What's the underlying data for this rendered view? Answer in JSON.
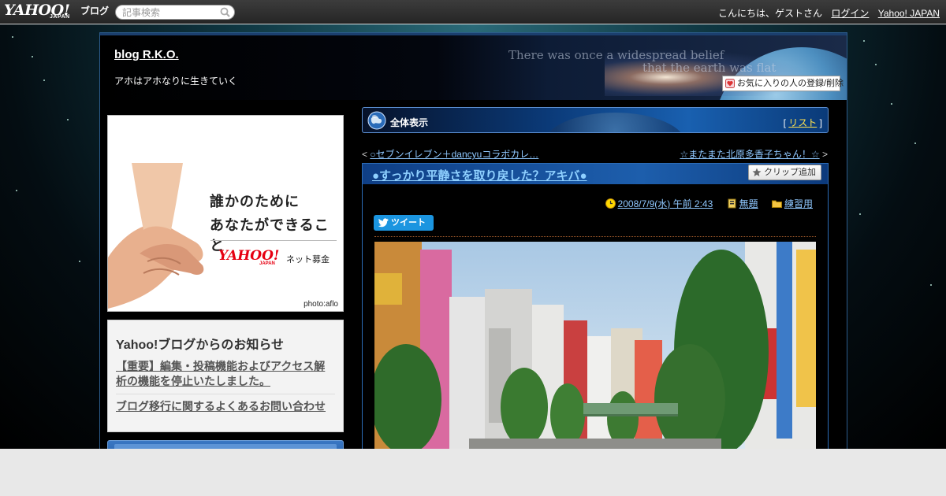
{
  "topbar": {
    "logo_main": "YAHOO!",
    "logo_sub": "JAPAN",
    "logo_service": "ブログ",
    "search_placeholder": "記事検索",
    "greeting": "こんにちは、ゲストさん",
    "login": "ログイン",
    "yahoo_japan": "Yahoo! JAPAN"
  },
  "header": {
    "blog_title": "blog R.K.O.",
    "blog_subtitle": "アホはアホなりに生きていく",
    "quote_line1": "There was once a widespread belief",
    "quote_line2": "that the earth was flat",
    "favorite_button": "お気に入りの人の登録/削除"
  },
  "ad": {
    "line1": "誰かのために",
    "line2": "あなたができること",
    "logo": "YAHOO!",
    "logo_sub": "JAPAN",
    "tagline": "ネット募金",
    "credit": "photo:aflo"
  },
  "notice": {
    "title": "Yahoo!ブログからのお知らせ",
    "items": [
      "【重要】編集・投稿機能およびアクセス解析の機能を停止いたしました。",
      "ブログ移行に関するよくあるお問い合わせ"
    ]
  },
  "main": {
    "section_title": "全体表示",
    "list_bracket_open": "[",
    "list_link": "リスト",
    "list_bracket_close": "]",
    "prev_marker": "<",
    "prev_link": "○セブンイレブン＋dancyuコラボカレ…",
    "next_link": "☆またまた北原多香子ちゃん！☆",
    "next_marker": ">"
  },
  "entry": {
    "title": "●すっかり平静さを取り戻した？アキバ●",
    "clip_button": "クリップ追加",
    "date": "2008/7/9(水) 午前 2:43",
    "tag": "無題",
    "category": "練習用",
    "tweet_button": "ツイート"
  },
  "colors": {
    "link_blue": "#8fc8ff",
    "list_link_yellow": "#ffe14d",
    "tweet_blue": "#1b95e0",
    "ad_red": "#e60012"
  }
}
